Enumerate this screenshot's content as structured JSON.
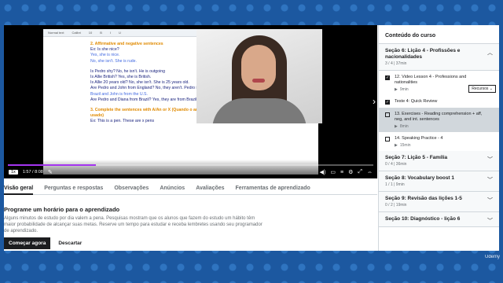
{
  "player": {
    "doc_toolbar": [
      "Normal text",
      "Calibri",
      "10",
      "B",
      "I",
      "U"
    ],
    "doc_lines": [
      {
        "t": "2. Affirmative and negative sentences",
        "c": "heading"
      },
      {
        "t": "Ex: Is she nice?",
        "c": "small"
      },
      {
        "t": "Yes, she is nice.",
        "c": "small a"
      },
      {
        "t": "No, she isn't. She is rude.",
        "c": "small a"
      },
      {
        "t": "",
        "c": "gap"
      },
      {
        "t": "Is Pedro shy? No, he isn't. He is outgoing",
        "c": "q"
      },
      {
        "t": "Is Allie British? Yes, she is British.",
        "c": "q"
      },
      {
        "t": "Is Allie 20 years old? No, she isn't. She is 25 years old.",
        "c": "q"
      },
      {
        "t": "Are Pedro and John from England? No, they aren't. Pedro is from",
        "c": "q"
      },
      {
        "t": "Brazil and John is from the U.S.",
        "c": "a"
      },
      {
        "t": "Are Pedro and Diana from Brazil? Yes, they are from Brazil",
        "c": "q"
      },
      {
        "t": "",
        "c": "gap"
      },
      {
        "t": "3. Complete the sentences with A/An or X (Quando o artigo não é",
        "c": "heading"
      },
      {
        "t": "usado)",
        "c": "heading"
      },
      {
        "t": "Ex: This is a pen. These are x pens",
        "c": "q"
      }
    ],
    "rate": "1x",
    "time": "1:57 / 8:08",
    "progress": 0.24
  },
  "tabs": [
    {
      "label": "Visão geral",
      "active": true
    },
    {
      "label": "Perguntas e respostas"
    },
    {
      "label": "Observações"
    },
    {
      "label": "Anúncios"
    },
    {
      "label": "Avaliações"
    },
    {
      "label": "Ferramentas de aprendizado"
    }
  ],
  "overview": {
    "title": "Programe um horário para o aprendizado",
    "body": "Alguns minutos de estudo por dia valem a pena. Pesquisas mostram que os alunos que fazem do estudo um hábito têm maior probabilidade de alcançar suas metas. Reserve um tempo para estudar e receba lembretes usando seu programador de aprendizado.",
    "primary": "Começar agora",
    "secondary": "Descartar"
  },
  "sidebar": {
    "title": "Conteúdo do curso",
    "open_section": {
      "title": "Seção 6: Lição 4 - Profissões e nacionalidades",
      "meta": "3 / 4 | 37min"
    },
    "lessons": [
      {
        "title": "12. Video Lesson 4 - Professions and nationalities",
        "meta": "9min",
        "checked": true,
        "resources": "Recursos"
      },
      {
        "title": "Teste 4: Quick Review",
        "meta": "",
        "checked": true
      },
      {
        "title": "13. Exercises - Reading comprehension + aff, neg, and int. sentences",
        "meta": "8min",
        "checked": false,
        "current": true
      },
      {
        "title": "14. Speaking Practice - 4",
        "meta": "15min",
        "checked": false
      }
    ],
    "sections": [
      {
        "title": "Seção 7: Lição 5 - Família",
        "meta": "0 / 4 | 36min"
      },
      {
        "title": "Seção 8: Vocabulary boost 1",
        "meta": "1 / 1 | 9min"
      },
      {
        "title": "Seção 9: Revisão das lições 1-5",
        "meta": "0 / 2 | 19min"
      },
      {
        "title": "Seção 10: Diagnóstico - lição 6",
        "meta": ""
      }
    ]
  },
  "watermark": "Udemy"
}
